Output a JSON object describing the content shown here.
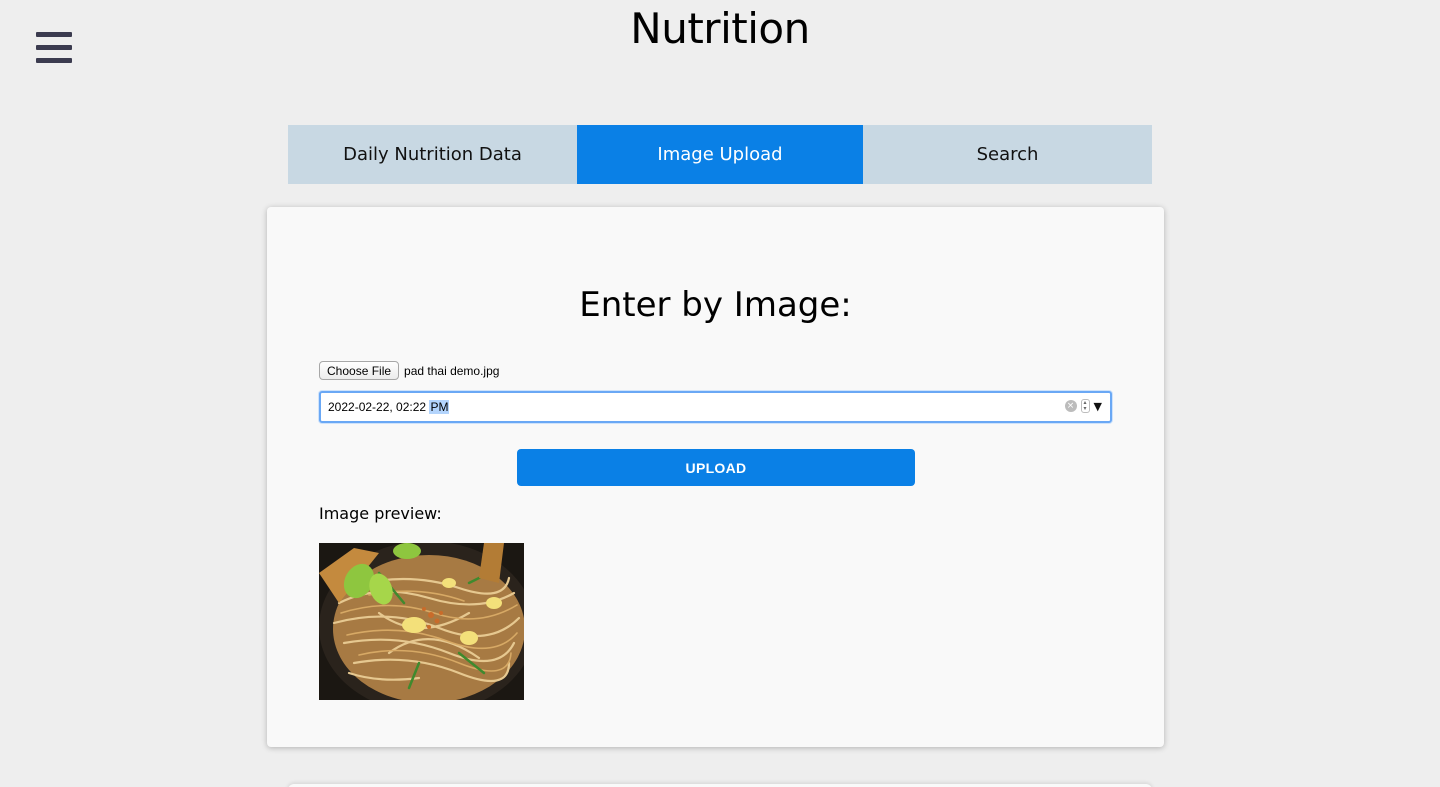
{
  "header": {
    "title": "Nutrition",
    "menu_icon": "hamburger-menu-icon"
  },
  "tabs": [
    {
      "label": "Daily Nutrition Data",
      "active": false
    },
    {
      "label": "Image Upload",
      "active": true
    },
    {
      "label": "Search",
      "active": false
    }
  ],
  "form": {
    "heading": "Enter by Image:",
    "file_button_label": "Choose File",
    "file_name": "pad thai demo.jpg",
    "datetime_value": "2022-02-22, 02:22",
    "datetime_ampm": "PM",
    "upload_label": "UPLOAD",
    "preview_label": "Image preview:"
  },
  "colors": {
    "accent": "#0a80e6",
    "tab_inactive": "#c8d8e3",
    "background": "#eeeeee",
    "card": "#f9f9f9"
  }
}
